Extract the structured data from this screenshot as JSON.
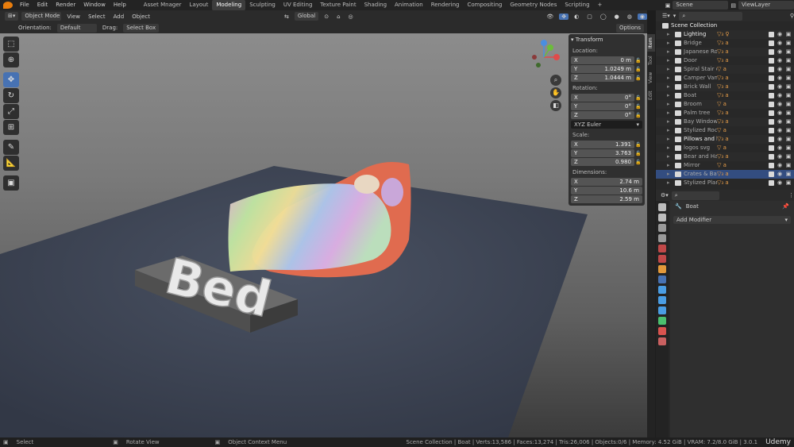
{
  "menu": [
    "File",
    "Edit",
    "Render",
    "Window",
    "Help"
  ],
  "workspaces": [
    {
      "label": "Asset Mnager",
      "active": false
    },
    {
      "label": "Layout",
      "active": false
    },
    {
      "label": "Modeling",
      "active": true
    },
    {
      "label": "Sculpting",
      "active": false
    },
    {
      "label": "UV Editing",
      "active": false
    },
    {
      "label": "Texture Paint",
      "active": false
    },
    {
      "label": "Shading",
      "active": false
    },
    {
      "label": "Animation",
      "active": false
    },
    {
      "label": "Rendering",
      "active": false
    },
    {
      "label": "Compositing",
      "active": false
    },
    {
      "label": "Geometry Nodes",
      "active": false
    },
    {
      "label": "Scripting",
      "active": false
    }
  ],
  "add_ws": "+",
  "scene": "Scene",
  "view_layer": "ViewLayer",
  "header": {
    "mode": "Object Mode",
    "view": "View",
    "select": "Select",
    "add": "Add",
    "object": "Object",
    "transform_orientation": "Global"
  },
  "header2": {
    "orientation_label": "Orientation:",
    "orientation": "Default",
    "drag_label": "Drag:",
    "drag": "Select Box",
    "options": "Options"
  },
  "scene_text": "Bed",
  "transform": {
    "title": "Transform",
    "location_label": "Location:",
    "location": [
      {
        "axis": "X",
        "val": "0 m"
      },
      {
        "axis": "Y",
        "val": "1.0249 m"
      },
      {
        "axis": "Z",
        "val": "1.0444 m"
      }
    ],
    "rotation_label": "Rotation:",
    "rotation": [
      {
        "axis": "X",
        "val": "0°"
      },
      {
        "axis": "Y",
        "val": "0°"
      },
      {
        "axis": "Z",
        "val": "0°"
      }
    ],
    "rotation_mode": "XYZ Euler",
    "scale_label": "Scale:",
    "scale": [
      {
        "axis": "X",
        "val": "1.391"
      },
      {
        "axis": "Y",
        "val": "3.763"
      },
      {
        "axis": "Z",
        "val": "0.980"
      }
    ],
    "dimensions_label": "Dimensions:",
    "dimensions": [
      {
        "axis": "X",
        "val": "2.74 m"
      },
      {
        "axis": "Y",
        "val": "10.6 m"
      },
      {
        "axis": "Z",
        "val": "2.59 m"
      }
    ]
  },
  "sidetabs": [
    {
      "label": "Item",
      "active": true
    },
    {
      "label": "Tool",
      "active": false
    },
    {
      "label": "View",
      "active": false
    },
    {
      "label": "Edit",
      "active": false
    }
  ],
  "outliner": {
    "root": "Scene Collection",
    "items": [
      {
        "name": "Lighting",
        "mods": "▽₃ ♀",
        "sel": false,
        "hi": true
      },
      {
        "name": "Bridge",
        "mods": "▽₃ a",
        "sel": false,
        "hi": false
      },
      {
        "name": "Japanese Roof",
        "mods": "▽₃ a",
        "sel": false,
        "hi": false
      },
      {
        "name": "Door",
        "mods": "▽₃ a",
        "sel": false,
        "hi": false
      },
      {
        "name": "Spiral Stair case",
        "mods": "▽ a",
        "sel": false,
        "hi": false
      },
      {
        "name": "Camper Van",
        "mods": "▽₃ a",
        "sel": false,
        "hi": false
      },
      {
        "name": "Brick Wall",
        "mods": "▽₃ a",
        "sel": false,
        "hi": false
      },
      {
        "name": "Boat",
        "mods": "▽₃ a",
        "sel": false,
        "hi": false
      },
      {
        "name": "Broom",
        "mods": "▽ a",
        "sel": false,
        "hi": false
      },
      {
        "name": "Palm tree",
        "mods": "▽₃ a",
        "sel": false,
        "hi": false
      },
      {
        "name": "Bay Window",
        "mods": "▽₃ a",
        "sel": false,
        "hi": false
      },
      {
        "name": "Stylized Rocks",
        "mods": "▽ a",
        "sel": false,
        "hi": false
      },
      {
        "name": "Pillows and bed",
        "mods": "▽₃ a",
        "sel": false,
        "hi": true
      },
      {
        "name": "logos svg",
        "mods": "▽ a",
        "sel": false,
        "hi": false
      },
      {
        "name": "Bear and Hair",
        "mods": "▽₃ a",
        "sel": false,
        "hi": false
      },
      {
        "name": "Mirror",
        "mods": "▽ a",
        "sel": false,
        "hi": false
      },
      {
        "name": "Crates & Barrels",
        "mods": "▽₃ a",
        "sel": true,
        "hi": false
      },
      {
        "name": "Stylized Plant",
        "mods": "▽₃ a",
        "sel": false,
        "hi": false
      }
    ]
  },
  "properties": {
    "object_name": "Boat",
    "add_modifier": "Add Modifier"
  },
  "status": {
    "select": "Select",
    "rotate": "Rotate View",
    "context": "Object Context Menu",
    "stats": "Scene Collection | Boat | Verts:13,586 | Faces:13,274 | Tris:26,006 | Objects:0/6 | Memory: 4.52 GiB | VRAM: 7.2/8.0 GiB | 3.0.1",
    "watermark": "Udemy"
  },
  "colors": {
    "accent": "#4772b3",
    "floor": "#3f4756",
    "bed_frame": "#e06b4f",
    "active_ws": "#3d3d3d"
  }
}
